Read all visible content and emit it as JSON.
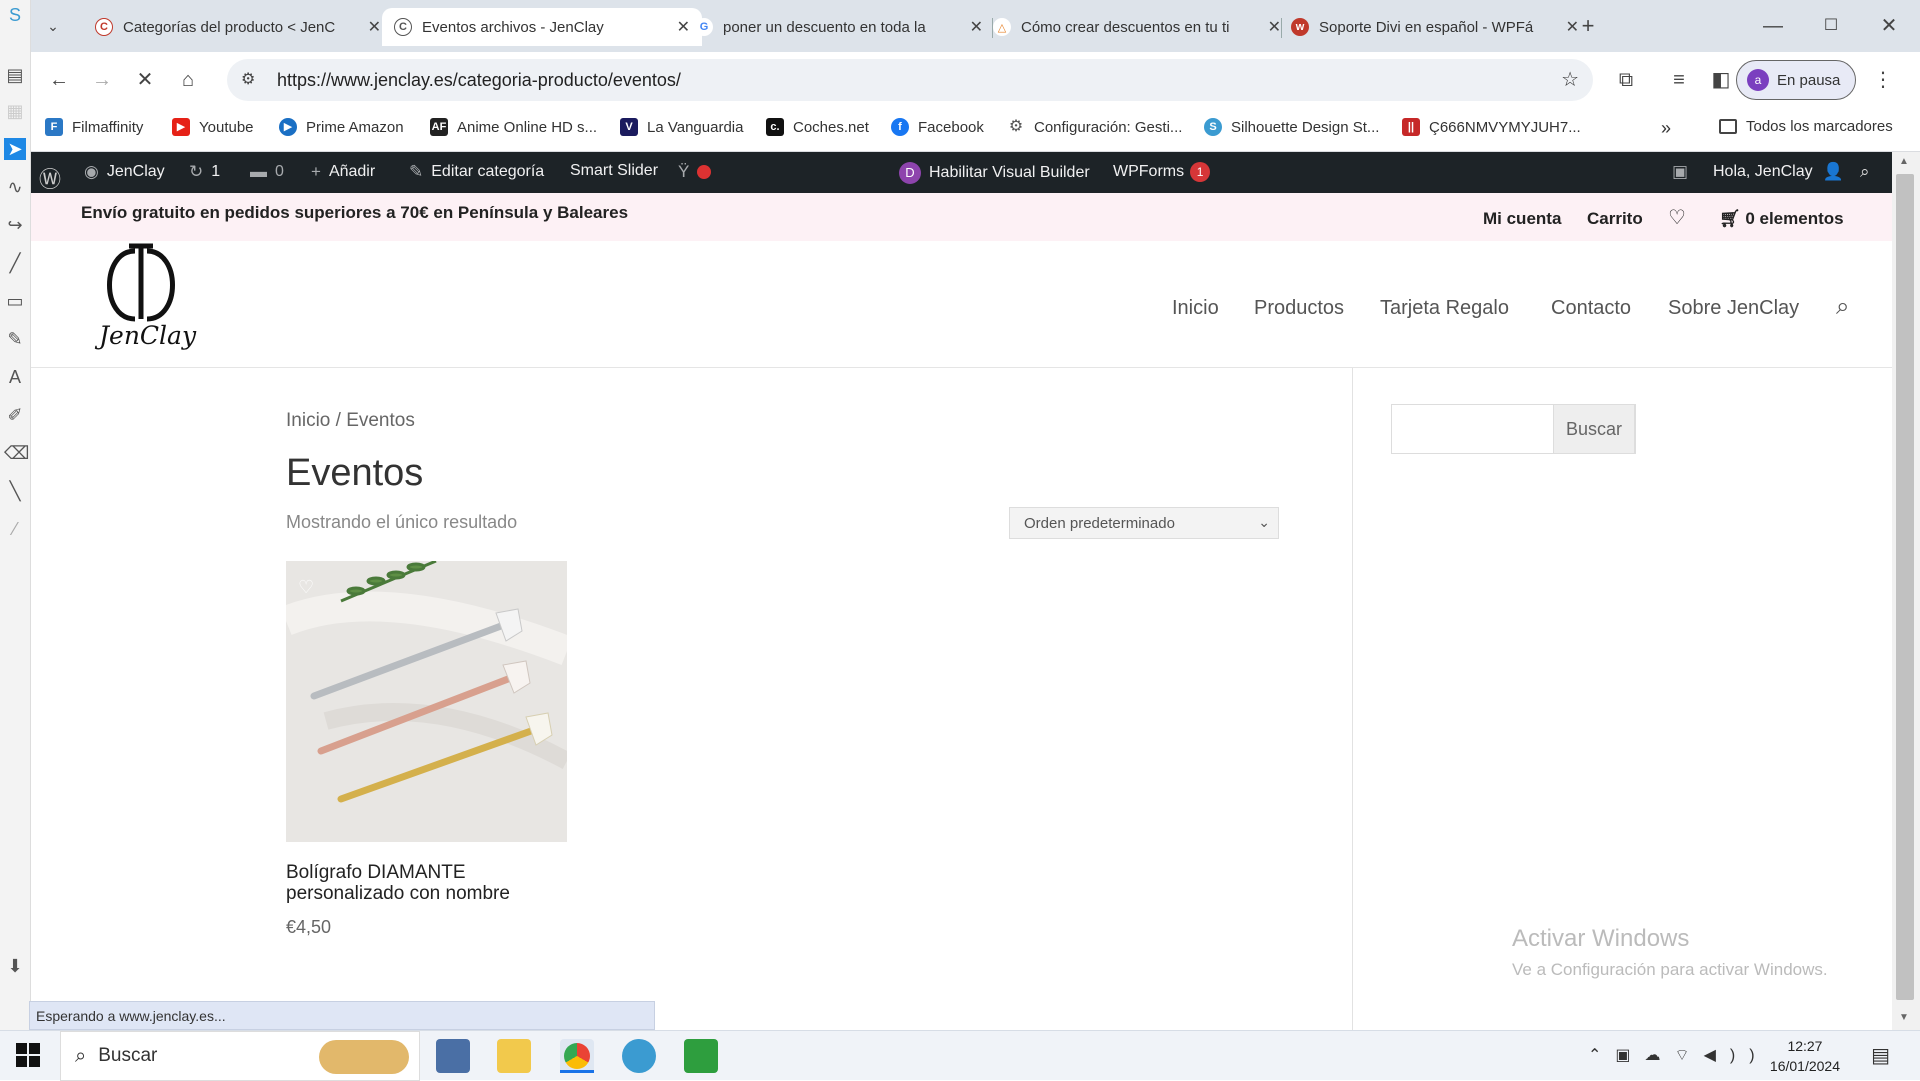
{
  "browser": {
    "tabs": [
      {
        "title": "Categorías del producto < JenC",
        "favicon_color": "#c0392b",
        "active": false
      },
      {
        "title": "Eventos archivos - JenClay",
        "favicon_color": "#555555",
        "active": true
      },
      {
        "title": "poner un descuento en toda la",
        "favicon_color": "#4285f4",
        "active": false
      },
      {
        "title": "Cómo crear descuentos en tu ti",
        "favicon_color": "#e67e22",
        "active": false
      },
      {
        "title": "Soporte Divi en español - WPFá",
        "favicon_color": "#c0392b",
        "active": false
      }
    ],
    "new_tab_label": "+",
    "url": "https://www.jenclay.es/categoria-producto/eventos/",
    "profile_initial": "a",
    "profile_label": "En pausa",
    "all_bookmarks_label": "Todos los marcadores",
    "bookmarks": [
      {
        "label": "Filmaffinity",
        "color": "#2b78c5"
      },
      {
        "label": "Youtube",
        "color": "#e62117"
      },
      {
        "label": "Prime Amazon",
        "color": "#1a6fc4"
      },
      {
        "label": "Anime Online HD s...",
        "color": "#222222"
      },
      {
        "label": "La Vanguardia",
        "color": "#1b1b5e"
      },
      {
        "label": "Coches.net",
        "color": "#111111"
      },
      {
        "label": "Facebook",
        "color": "#1877f2"
      },
      {
        "label": "Configuración: Gesti...",
        "color": "#666666"
      },
      {
        "label": "Silhouette Design St...",
        "color": "#3b9bd1"
      },
      {
        "label": "Ç666NMVYMYJUH7...",
        "color": "#c62828"
      }
    ]
  },
  "wp_admin_bar": {
    "site_name": "JenClay",
    "updates_count": "1",
    "comments_count": "0",
    "add_label": "Añadir",
    "edit_label": "Editar categoría",
    "slider_label": "Smart Slider",
    "visual_builder_label": "Habilitar Visual Builder",
    "wpforms_label": "WPForms",
    "wpforms_badge": "1",
    "greeting": "Hola, JenClay"
  },
  "site": {
    "shipping_notice": "Envío gratuito en pedidos superiores a 70€ en Península y Baleares",
    "top_links": {
      "account": "Mi cuenta",
      "cart": "Carrito",
      "cart_items": "0 elementos"
    },
    "logo_text": "JenClay",
    "menu": [
      "Inicio",
      "Productos",
      "Tarjeta Regalo",
      "Contacto",
      "Sobre JenClay"
    ]
  },
  "category": {
    "breadcrumb": "Inicio / Eventos",
    "title": "Eventos",
    "result_count": "Mostrando el único resultado",
    "orderby": "Orden predeterminado",
    "product": {
      "name": "Bolígrafo DIAMANTE personalizado con nombre",
      "price": "€4,50"
    }
  },
  "sidebar": {
    "search_button": "Buscar"
  },
  "watermark": {
    "line1": "Activar Windows",
    "line2": "Ve a Configuración para activar Windows."
  },
  "status_text": "Esperando a www.jenclay.es...",
  "taskbar": {
    "search_placeholder": "Buscar",
    "time": "12:27",
    "date": "16/01/2024"
  }
}
